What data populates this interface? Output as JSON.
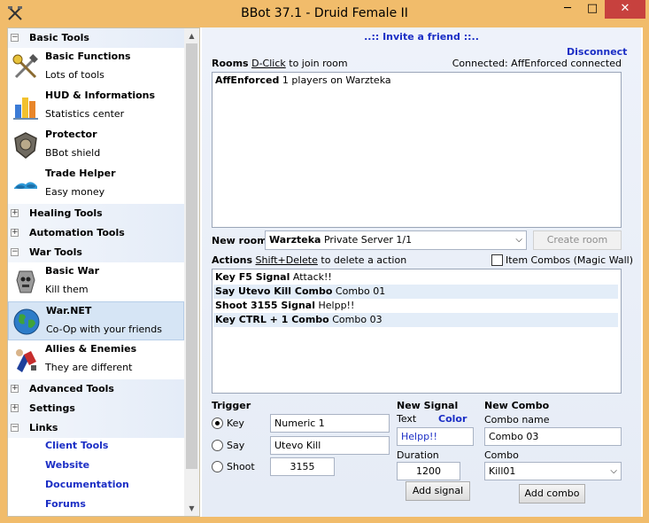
{
  "window": {
    "title": "BBot 37.1 - Druid Female II",
    "minimize": "─",
    "maximize": "□",
    "close": "✕",
    "app_icon": "crossed-tools-icon"
  },
  "sidebar": {
    "groups": {
      "basic_tools": {
        "label": "Basic Tools",
        "toggle": "−"
      },
      "healing_tools": {
        "label": "Healing Tools",
        "toggle": "+"
      },
      "automation_tools": {
        "label": "Automation Tools",
        "toggle": "+"
      },
      "war_tools": {
        "label": "War Tools",
        "toggle": "−"
      },
      "advanced_tools": {
        "label": "Advanced Tools",
        "toggle": "+"
      },
      "settings": {
        "label": "Settings",
        "toggle": "+"
      },
      "links": {
        "label": "Links",
        "toggle": "−"
      }
    },
    "items": {
      "basic_functions": {
        "title": "Basic Functions",
        "sub": "Lots of tools",
        "icon": "wrench-hammer-icon"
      },
      "hud": {
        "title": "HUD & Informations",
        "sub": "Statistics center",
        "icon": "bar-chart-icon"
      },
      "protector": {
        "title": "Protector",
        "sub": "BBot shield",
        "icon": "shield-icon"
      },
      "trade_helper": {
        "title": "Trade Helper",
        "sub": "Easy money",
        "icon": "coins-icon"
      },
      "basic_war": {
        "title": "Basic War",
        "sub": "Kill them",
        "icon": "skull-stone-icon"
      },
      "war_net": {
        "title": "War.NET",
        "sub": "Co-Op with your friends",
        "icon": "globe-icon"
      },
      "allies": {
        "title": "Allies & Enemies",
        "sub": "They are different",
        "icon": "knight-icon"
      }
    },
    "links": [
      "Client Tools",
      "Website",
      "Documentation",
      "Forums"
    ],
    "scroll_up": "▲",
    "scroll_down": "▼"
  },
  "main": {
    "invite": "..:: Invite a friend ::..",
    "disconnect": "Disconnect",
    "rooms_label": "Rooms",
    "rooms_hint_key": "D-Click",
    "rooms_hint_rest": "to join room",
    "connection_status": "Connected: AffEnforced connected",
    "rooms": [
      {
        "name": "AffEnforced",
        "info": "1 players on Warzteka"
      }
    ],
    "new_room_label": "New room",
    "new_room_value_bold": "Warzteka",
    "new_room_value_rest": "Private Server 1/1",
    "create_room": "Create room",
    "actions_label": "Actions",
    "actions_hint_key": "Shift+Delete",
    "actions_hint_rest": "to delete a action",
    "item_combos_label": "Item Combos (Magic Wall)",
    "actions": [
      {
        "bold": "Key F5 Signal",
        "rest": "Attack!!"
      },
      {
        "bold": "Say Utevo Kill Combo",
        "rest": "Combo 01"
      },
      {
        "bold": "Shoot 3155 Signal",
        "rest": "Helpp!!"
      },
      {
        "bold": "Key CTRL + 1 Combo",
        "rest": "Combo 03"
      }
    ],
    "trigger": {
      "heading": "Trigger",
      "key_label": "Key",
      "say_label": "Say",
      "shoot_label": "Shoot",
      "key_value": "Numeric 1",
      "say_value": "Utevo Kill",
      "shoot_value": "3155"
    },
    "signal": {
      "heading": "New Signal",
      "text_label": "Text",
      "color_label": "Color",
      "text_value": "Helpp!!",
      "duration_label": "Duration",
      "duration_value": "1200",
      "add_button": "Add signal"
    },
    "combo": {
      "heading": "New Combo",
      "name_label": "Combo name",
      "name_value": "Combo 03",
      "combo_label": "Combo",
      "combo_value": "Kill01",
      "add_button": "Add combo"
    }
  },
  "colors": {
    "title_bar": "#f1bc6b",
    "link_blue": "#1b2ec5",
    "selected_item": "#d6e5f5",
    "close_button": "#c7413e"
  }
}
